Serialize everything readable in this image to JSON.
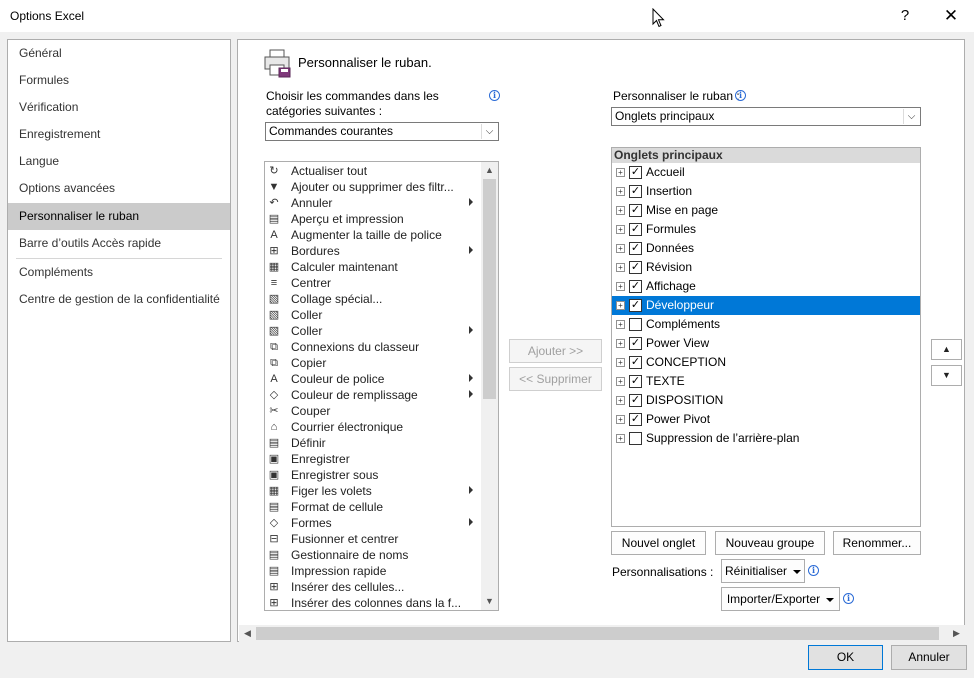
{
  "window": {
    "title": "Options Excel",
    "help": "?",
    "close": "✕"
  },
  "nav": {
    "items": [
      {
        "label": "Général"
      },
      {
        "label": "Formules"
      },
      {
        "label": "Vérification"
      },
      {
        "label": "Enregistrement"
      },
      {
        "label": "Langue"
      },
      {
        "label": "Options avancées"
      },
      {
        "label": "Personnaliser le ruban",
        "active": true
      },
      {
        "label": "Barre d’outils Accès rapide"
      },
      {
        "label": "Compléments"
      },
      {
        "label": "Centre de gestion de la confidentialité"
      }
    ]
  },
  "header": {
    "title": "Personnaliser le ruban."
  },
  "left": {
    "choose_label_line1": "Choisir les commandes dans les",
    "choose_label_line2": "catégories suivantes :",
    "combo_value": "Commandes courantes",
    "commands": [
      {
        "label": "Actualiser tout",
        "icon": "↻"
      },
      {
        "label": "Ajouter ou supprimer des filtr...",
        "icon": "▼"
      },
      {
        "label": "Annuler",
        "icon": "↶",
        "sub": true
      },
      {
        "label": "Aperçu et impression",
        "icon": "▤"
      },
      {
        "label": "Augmenter la taille de police",
        "icon": "A"
      },
      {
        "label": "Bordures",
        "icon": "⊞",
        "sub": true
      },
      {
        "label": "Calculer maintenant",
        "icon": "▦"
      },
      {
        "label": "Centrer",
        "icon": "≡"
      },
      {
        "label": "Collage spécial...",
        "icon": "▧"
      },
      {
        "label": "Coller",
        "icon": "▧"
      },
      {
        "label": "Coller",
        "icon": "▧",
        "sub": true
      },
      {
        "label": "Connexions du classeur",
        "icon": "⧉"
      },
      {
        "label": "Copier",
        "icon": "⧉"
      },
      {
        "label": "Couleur de police",
        "icon": "A",
        "sub": true
      },
      {
        "label": "Couleur de remplissage",
        "icon": "◇",
        "sub": true
      },
      {
        "label": "Couper",
        "icon": "✂"
      },
      {
        "label": "Courrier électronique",
        "icon": "⌂"
      },
      {
        "label": "Définir",
        "icon": "▤"
      },
      {
        "label": "Enregistrer",
        "icon": "▣"
      },
      {
        "label": "Enregistrer sous",
        "icon": "▣"
      },
      {
        "label": "Figer les volets",
        "icon": "▦",
        "sub": true
      },
      {
        "label": "Format de cellule",
        "icon": "▤"
      },
      {
        "label": "Formes",
        "icon": "◇",
        "sub": true
      },
      {
        "label": "Fusionner et centrer",
        "icon": "⊟"
      },
      {
        "label": "Gestionnaire de noms",
        "icon": "▤"
      },
      {
        "label": "Impression rapide",
        "icon": "▤"
      },
      {
        "label": "Insérer des cellules...",
        "icon": "⊞"
      },
      {
        "label": "Insérer des colonnes dans la f...",
        "icon": "⊞"
      }
    ]
  },
  "middle": {
    "add": "Ajouter >>",
    "remove": "<< Supprimer"
  },
  "right": {
    "label": "Personnaliser le ruban :",
    "combo_value": "Onglets principaux",
    "tree_header": "Onglets principaux",
    "tabs": [
      {
        "label": "Accueil",
        "checked": true
      },
      {
        "label": "Insertion",
        "checked": true
      },
      {
        "label": "Mise en page",
        "checked": true
      },
      {
        "label": "Formules",
        "checked": true
      },
      {
        "label": "Données",
        "checked": true
      },
      {
        "label": "Révision",
        "checked": true
      },
      {
        "label": "Affichage",
        "checked": true
      },
      {
        "label": "Développeur",
        "checked": true,
        "selected": true
      },
      {
        "label": "Compléments",
        "checked": false
      },
      {
        "label": "Power View",
        "checked": true
      },
      {
        "label": "CONCEPTION",
        "checked": true
      },
      {
        "label": "TEXTE",
        "checked": true
      },
      {
        "label": "DISPOSITION",
        "checked": true
      },
      {
        "label": "Power Pivot",
        "checked": true
      },
      {
        "label": "Suppression de l’arrière-plan",
        "checked": false
      }
    ],
    "new_tab": "Nouvel onglet",
    "new_group": "Nouveau groupe",
    "rename": "Renommer...",
    "customizations_label": "Personnalisations :",
    "reset": "Réinitialiser",
    "import_export": "Importer/Exporter"
  },
  "footer": {
    "ok": "OK",
    "cancel": "Annuler"
  }
}
